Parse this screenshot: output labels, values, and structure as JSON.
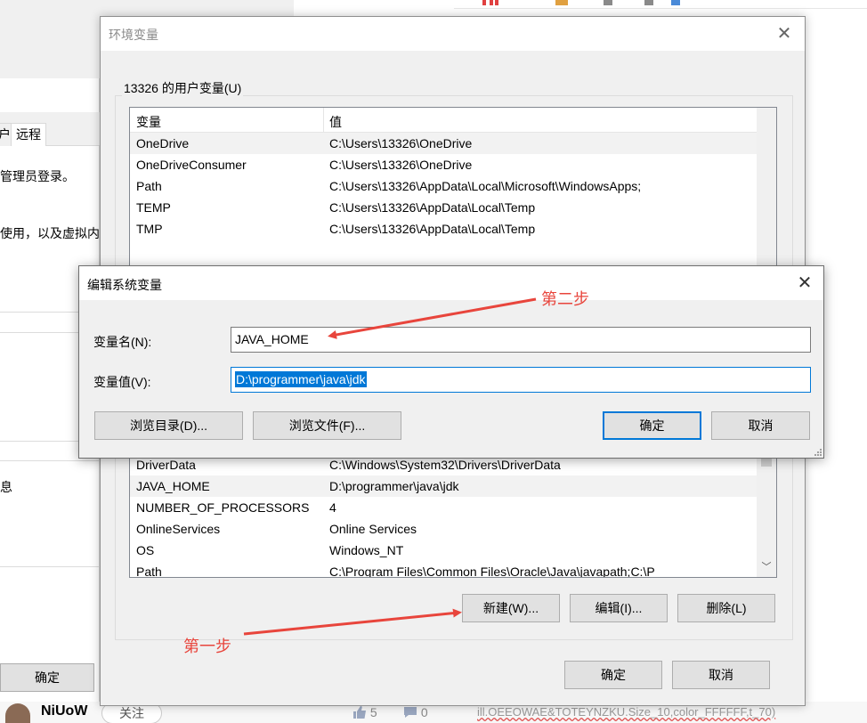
{
  "background": {
    "tabs": [
      "户",
      "远程"
    ],
    "texts": [
      "管理员登录。",
      "使用，以及虚拟内",
      "息"
    ],
    "ok_button": "确定",
    "user_name": "NiUoW",
    "follow_label": "关注",
    "like_count": "5",
    "comment_count": "0",
    "code_snippet": "ill.OEEOWAE&TOTEYNZKU.Size_10,color_FFFFFF,t_70)"
  },
  "env_dialog": {
    "title": "环境变量",
    "close_glyph": "✕",
    "user_group_label": "13326 的用户变量(U)",
    "columns": [
      "变量",
      "值"
    ],
    "user_vars": [
      {
        "name": "OneDrive",
        "value": "C:\\Users\\13326\\OneDrive"
      },
      {
        "name": "OneDriveConsumer",
        "value": "C:\\Users\\13326\\OneDrive"
      },
      {
        "name": "Path",
        "value": "C:\\Users\\13326\\AppData\\Local\\Microsoft\\WindowsApps;"
      },
      {
        "name": "TEMP",
        "value": "C:\\Users\\13326\\AppData\\Local\\Temp"
      },
      {
        "name": "TMP",
        "value": "C:\\Users\\13326\\AppData\\Local\\Temp"
      }
    ],
    "system_vars": [
      {
        "name": "DriverData",
        "value": "C:\\Windows\\System32\\Drivers\\DriverData"
      },
      {
        "name": "JAVA_HOME",
        "value": "D:\\programmer\\java\\jdk"
      },
      {
        "name": "NUMBER_OF_PROCESSORS",
        "value": "4"
      },
      {
        "name": "OnlineServices",
        "value": "Online Services"
      },
      {
        "name": "OS",
        "value": "Windows_NT"
      },
      {
        "name": "Path",
        "value": "C:\\Program Files\\Common Files\\Oracle\\Java\\javapath;C:\\P"
      }
    ],
    "buttons": {
      "new": "新建(W)...",
      "edit": "编辑(I)...",
      "delete": "删除(L)"
    },
    "ok": "确定",
    "cancel": "取消"
  },
  "edit_dialog": {
    "title": "编辑系统变量",
    "close_glyph": "✕",
    "name_label": "变量名(N):",
    "name_value": "JAVA_HOME",
    "value_label": "变量值(V):",
    "value_value": "D:\\programmer\\java\\jdk",
    "browse_dir": "浏览目录(D)...",
    "browse_file": "浏览文件(F)...",
    "ok": "确定",
    "cancel": "取消"
  },
  "annotations": {
    "step1": "第一步",
    "step2": "第二步",
    "color": "#e8453c"
  }
}
